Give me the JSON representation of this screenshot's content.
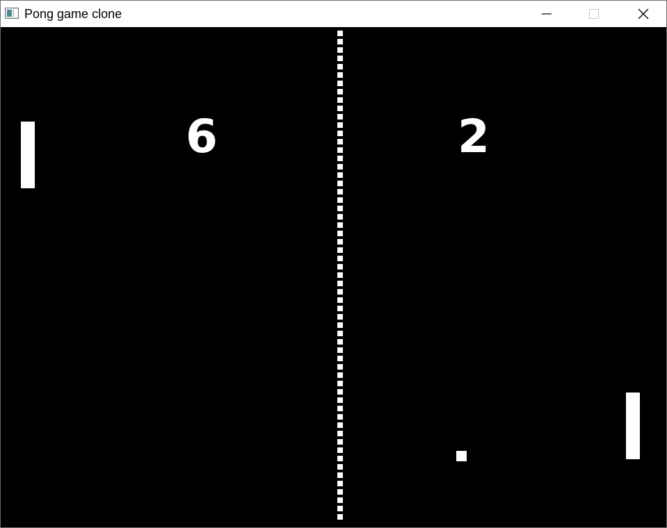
{
  "window": {
    "title": "Pong game clone",
    "icon": "app-window-icon",
    "controls": {
      "minimize": "minimize-icon",
      "maximize": "maximize-icon",
      "close": "close-icon"
    }
  },
  "game": {
    "background_color": "#000000",
    "foreground_color": "#ffffff",
    "score": {
      "left": "6",
      "right": "2"
    }
  }
}
